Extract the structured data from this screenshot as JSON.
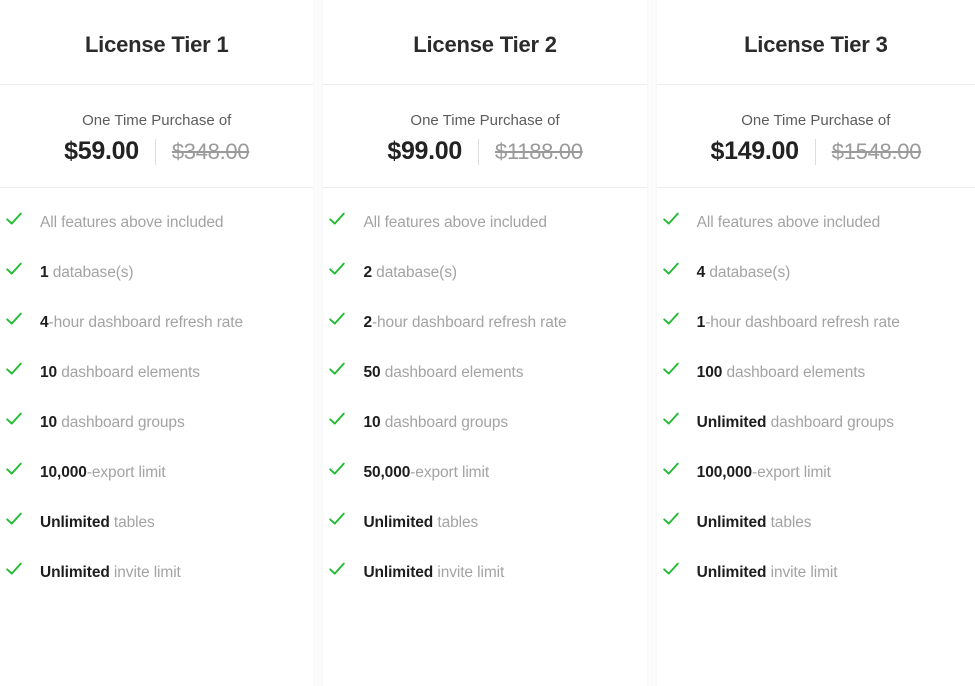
{
  "colors": {
    "check_green": "#22bb33",
    "title_dark": "#2b2b2b",
    "price_dark": "#222222",
    "price_struck": "#9a9a9a",
    "feature_gray": "#a3a3a3",
    "feature_bold": "#1d1d1d",
    "rule_gray": "#ececec"
  },
  "icons": {
    "check": "check-icon"
  },
  "tiers": [
    {
      "title": "License Tier 1",
      "price_caption": "One Time Purchase of",
      "price_current": "$59.00",
      "price_original": "$348.00",
      "features": [
        {
          "strong": "",
          "rest": "All features above included"
        },
        {
          "strong": "1",
          "rest": " database(s)"
        },
        {
          "strong": "4",
          "rest": "-hour dashboard refresh rate"
        },
        {
          "strong": "10",
          "rest": " dashboard elements"
        },
        {
          "strong": "10",
          "rest": " dashboard groups"
        },
        {
          "strong": "10,000",
          "rest": "-export limit"
        },
        {
          "strong": "Unlimited",
          "rest": " tables"
        },
        {
          "strong": "Unlimited",
          "rest": " invite limit"
        }
      ]
    },
    {
      "title": "License Tier 2",
      "price_caption": "One Time Purchase of",
      "price_current": "$99.00",
      "price_original": "$1188.00",
      "features": [
        {
          "strong": "",
          "rest": "All features above included"
        },
        {
          "strong": "2",
          "rest": " database(s)"
        },
        {
          "strong": "2",
          "rest": "-hour dashboard refresh rate"
        },
        {
          "strong": "50",
          "rest": " dashboard elements"
        },
        {
          "strong": "10",
          "rest": " dashboard groups"
        },
        {
          "strong": "50,000",
          "rest": "-export limit"
        },
        {
          "strong": "Unlimited",
          "rest": " tables"
        },
        {
          "strong": "Unlimited",
          "rest": " invite limit"
        }
      ]
    },
    {
      "title": "License Tier 3",
      "price_caption": "One Time Purchase of",
      "price_current": "$149.00",
      "price_original": "$1548.00",
      "features": [
        {
          "strong": "",
          "rest": "All features above included"
        },
        {
          "strong": "4",
          "rest": " database(s)"
        },
        {
          "strong": "1",
          "rest": "-hour dashboard refresh rate"
        },
        {
          "strong": "100",
          "rest": " dashboard elements"
        },
        {
          "strong": "Unlimited",
          "rest": " dashboard groups"
        },
        {
          "strong": "100,000",
          "rest": "-export limit"
        },
        {
          "strong": "Unlimited",
          "rest": " tables"
        },
        {
          "strong": "Unlimited",
          "rest": " invite limit"
        }
      ]
    }
  ]
}
